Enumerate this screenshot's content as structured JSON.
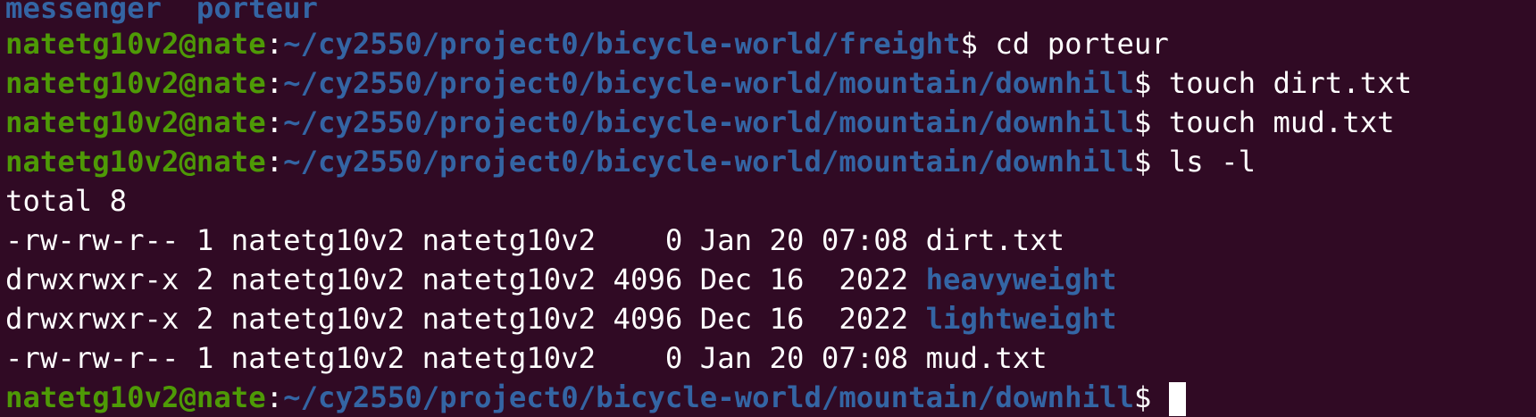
{
  "terminal": {
    "colors": {
      "background": "#300a24",
      "user": "#4e9a06",
      "path": "#3465a4",
      "text": "#ffffff"
    },
    "top_partial": {
      "a": "messenger",
      "b": "porteur"
    },
    "lines": [
      {
        "user": "natetg10v2@nate",
        "colon": ":",
        "path": "~/cy2550/project0/bicycle-world/freight",
        "dollar": "$",
        "cmd": " cd porteur"
      },
      {
        "user": "natetg10v2@nate",
        "colon": ":",
        "path": "~/cy2550/project0/bicycle-world/mountain/downhill",
        "dollar": "$",
        "cmd": " touch dirt.txt"
      },
      {
        "user": "natetg10v2@nate",
        "colon": ":",
        "path": "~/cy2550/project0/bicycle-world/mountain/downhill",
        "dollar": "$",
        "cmd": " touch mud.txt"
      },
      {
        "user": "natetg10v2@nate",
        "colon": ":",
        "path": "~/cy2550/project0/bicycle-world/mountain/downhill",
        "dollar": "$",
        "cmd": " ls -l"
      }
    ],
    "ls_output": {
      "total": "total 8",
      "entries": [
        {
          "meta": "-rw-rw-r-- 1 natetg10v2 natetg10v2    0 Jan 20 07:08 ",
          "name": "dirt.txt",
          "is_dir": false
        },
        {
          "meta": "drwxrwxr-x 2 natetg10v2 natetg10v2 4096 Dec 16  2022 ",
          "name": "heavyweight",
          "is_dir": true
        },
        {
          "meta": "drwxrwxr-x 2 natetg10v2 natetg10v2 4096 Dec 16  2022 ",
          "name": "lightweight",
          "is_dir": true
        },
        {
          "meta": "-rw-rw-r-- 1 natetg10v2 natetg10v2    0 Jan 20 07:08 ",
          "name": "mud.txt",
          "is_dir": false
        }
      ]
    },
    "final_prompt": {
      "user": "natetg10v2@nate",
      "colon": ":",
      "path": "~/cy2550/project0/bicycle-world/mountain/downhill",
      "dollar": "$",
      "cmd": " "
    }
  }
}
